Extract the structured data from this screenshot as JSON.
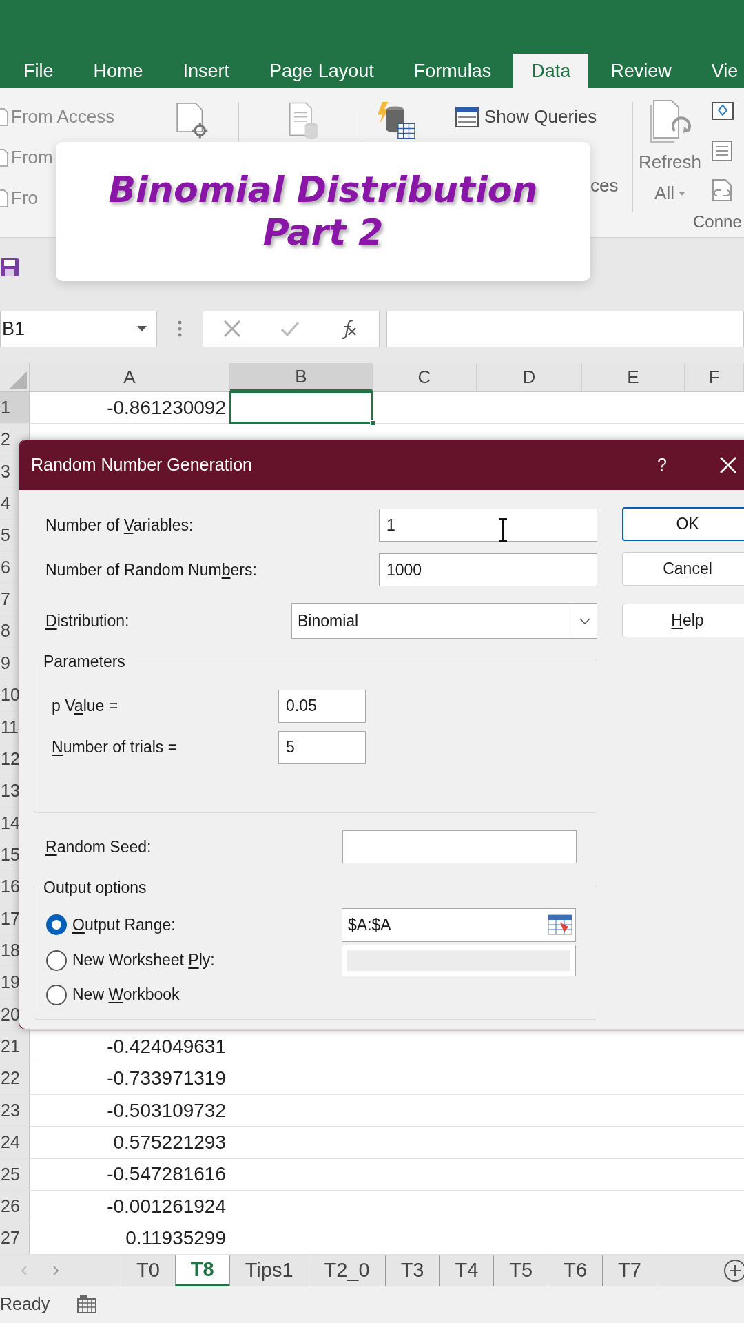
{
  "ribbon_tabs": [
    {
      "label": "File",
      "selected": false
    },
    {
      "label": "Home",
      "selected": false
    },
    {
      "label": "Insert",
      "selected": false
    },
    {
      "label": "Page Layout",
      "selected": false
    },
    {
      "label": "Formulas",
      "selected": false
    },
    {
      "label": "Data",
      "selected": true
    },
    {
      "label": "Review",
      "selected": false
    },
    {
      "label": "Vie",
      "selected": false
    }
  ],
  "ribbon": {
    "left_items": [
      "From Access",
      "From",
      "Fro"
    ],
    "show_queries": "Show Queries",
    "partial_label": "ces",
    "refresh": [
      "Refresh",
      "All"
    ],
    "group_label": "Conne"
  },
  "overlay_title": [
    "Binomial Distribution",
    "Part 2"
  ],
  "name_box": "B1",
  "columns": [
    {
      "label": "A",
      "selected": false
    },
    {
      "label": "B",
      "selected": true
    },
    {
      "label": "C",
      "selected": false
    },
    {
      "label": "D",
      "selected": false
    },
    {
      "label": "E",
      "selected": false
    },
    {
      "label": "F",
      "selected": false
    }
  ],
  "rows": [
    {
      "number": "1",
      "a": "-0.861230092",
      "selected": true
    },
    {
      "number": "2",
      "selected": false
    },
    {
      "number": "3",
      "selected": false
    },
    {
      "number": "4",
      "selected": false
    },
    {
      "number": "5",
      "selected": false
    },
    {
      "number": "6",
      "selected": false
    },
    {
      "number": "7",
      "selected": false
    },
    {
      "number": "8",
      "selected": false
    },
    {
      "number": "9",
      "selected": false
    },
    {
      "number": "10",
      "selected": false
    },
    {
      "number": "11",
      "selected": false
    },
    {
      "number": "12",
      "selected": false
    },
    {
      "number": "13",
      "selected": false
    },
    {
      "number": "14",
      "selected": false
    },
    {
      "number": "15",
      "selected": false
    },
    {
      "number": "16",
      "selected": false
    },
    {
      "number": "17",
      "selected": false
    },
    {
      "number": "18",
      "selected": false
    },
    {
      "number": "19",
      "selected": false
    },
    {
      "number": "20",
      "selected": false
    },
    {
      "number": "21",
      "a": "-0.424049631",
      "selected": false
    },
    {
      "number": "22",
      "a": "-0.733971319",
      "selected": false
    },
    {
      "number": "23",
      "a": "-0.503109732",
      "selected": false
    },
    {
      "number": "24",
      "a": "0.575221293",
      "selected": false
    },
    {
      "number": "25",
      "a": "-0.547281616",
      "selected": false
    },
    {
      "number": "26",
      "a": "-0.001261924",
      "selected": false
    },
    {
      "number": "27",
      "a": "0.11935299",
      "selected": false
    }
  ],
  "sheet_tabs": [
    {
      "label": "T0",
      "selected": false
    },
    {
      "label": "T8",
      "selected": true
    },
    {
      "label": "Tips1",
      "selected": false
    },
    {
      "label": "T2_0",
      "selected": false
    },
    {
      "label": "T3",
      "selected": false
    },
    {
      "label": "T4",
      "selected": false
    },
    {
      "label": "T5",
      "selected": false
    },
    {
      "label": "T6",
      "selected": false
    },
    {
      "label": "T7",
      "selected": false
    }
  ],
  "status": "Ready",
  "dialog": {
    "title": "Random Number Generation",
    "help": "?",
    "fields": [
      {
        "label": [
          {
            "text": "Number of ",
            "underline": false
          },
          {
            "text": "V",
            "underline": true
          },
          {
            "text": "ariables:",
            "underline": false
          }
        ],
        "value": "1"
      },
      {
        "label": [
          {
            "text": "Number of Random Num",
            "underline": false
          },
          {
            "text": "b",
            "underline": true
          },
          {
            "text": "ers:",
            "underline": false
          }
        ],
        "value": "1000"
      }
    ],
    "distribution": {
      "label": [
        {
          "text": "D",
          "underline": true
        },
        {
          "text": "istribution:",
          "underline": false
        }
      ],
      "value": "Binomial"
    },
    "parameters": {
      "title": "Parameters",
      "fields": [
        {
          "label": [
            {
              "text": "p V",
              "underline": false
            },
            {
              "text": "a",
              "underline": true
            },
            {
              "text": "lue =",
              "underline": false
            }
          ],
          "value": "0.05"
        },
        {
          "label": [
            {
              "text": "N",
              "underline": true
            },
            {
              "text": "umber of trials =",
              "underline": false
            }
          ],
          "value": "5"
        }
      ]
    },
    "random_seed": {
      "label": [
        {
          "text": "R",
          "underline": true
        },
        {
          "text": "andom Seed:",
          "underline": false
        }
      ]
    },
    "output": {
      "title": "Output options",
      "options": [
        {
          "kind": "range",
          "selected": true,
          "value": "$A:$A",
          "label": [
            {
              "text": "O",
              "underline": true
            },
            {
              "text": "utput Range:",
              "underline": false
            }
          ]
        },
        {
          "kind": "disabled_field",
          "selected": false,
          "label": [
            {
              "text": "New Worksheet ",
              "underline": false
            },
            {
              "text": "P",
              "underline": true
            },
            {
              "text": "ly:",
              "underline": false
            }
          ]
        },
        {
          "kind": "plain",
          "selected": false,
          "label": [
            {
              "text": "New ",
              "underline": false
            },
            {
              "text": "W",
              "underline": true
            },
            {
              "text": "orkbook",
              "underline": false
            }
          ]
        }
      ]
    },
    "buttons": [
      {
        "label": [
          {
            "text": "OK",
            "underline": false
          }
        ],
        "default": true
      },
      {
        "label": [
          {
            "text": "Cancel",
            "underline": false
          }
        ],
        "default": false
      },
      {
        "label": [
          {
            "text": "H",
            "underline": true
          },
          {
            "text": "elp",
            "underline": false
          }
        ],
        "default": false
      }
    ]
  }
}
